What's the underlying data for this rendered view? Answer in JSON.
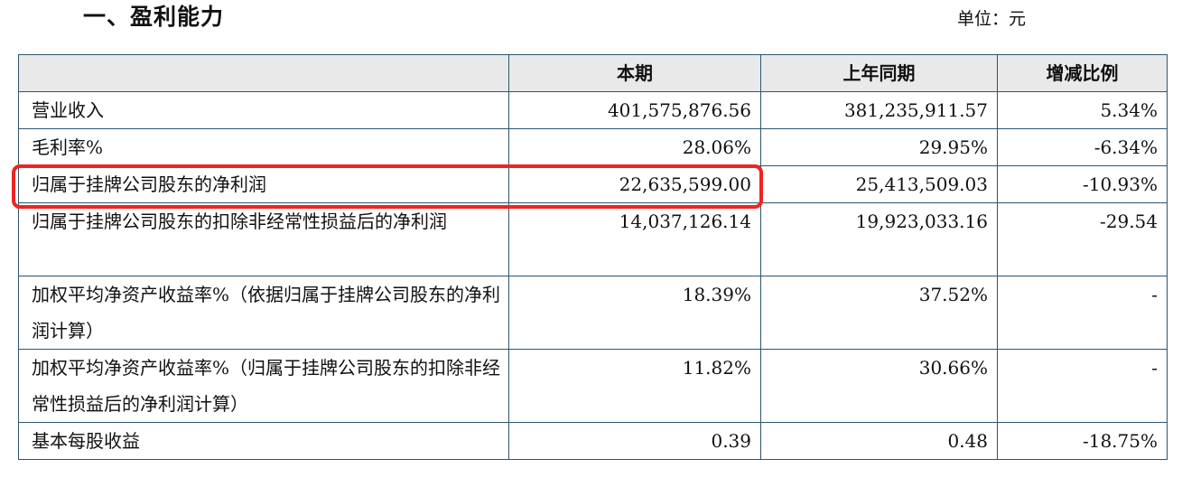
{
  "header": {
    "section_title": "一、盈利能力",
    "unit_label": "单位：元"
  },
  "table": {
    "columns": [
      "",
      "本期",
      "上年同期",
      "增减比例"
    ],
    "rows": [
      {
        "label": "营业收入",
        "current": "401,575,876.56",
        "previous": "381,235,911.57",
        "change": "5.34%"
      },
      {
        "label": "毛利率%",
        "current": "28.06%",
        "previous": "29.95%",
        "change": "-6.34%"
      },
      {
        "label": "归属于挂牌公司股东的净利润",
        "current": "22,635,599.00",
        "previous": "25,413,509.03",
        "change": "-10.93%"
      },
      {
        "label": "归属于挂牌公司股东的扣除非经常性损益后的净利润",
        "current": "14,037,126.14",
        "previous": "19,923,033.16",
        "change": "-29.54"
      },
      {
        "label": "加权平均净资产收益率%（依据归属于挂牌公司股东的净利润计算）",
        "current": "18.39%",
        "previous": "37.52%",
        "change": "-"
      },
      {
        "label": "加权平均净资产收益率%（归属于挂牌公司股东的扣除非经常性损益后的净利润计算）",
        "current": "11.82%",
        "previous": "30.66%",
        "change": "-"
      },
      {
        "label": "基本每股收益",
        "current": "0.39",
        "previous": "0.48",
        "change": "-18.75%"
      }
    ]
  },
  "annotation": {
    "highlight_color": "#ee2420",
    "highlighted_row": "归属于挂牌公司股东的净利润"
  },
  "colors": {
    "header_bg": "#e9e9e9",
    "border": "#2c5572"
  }
}
